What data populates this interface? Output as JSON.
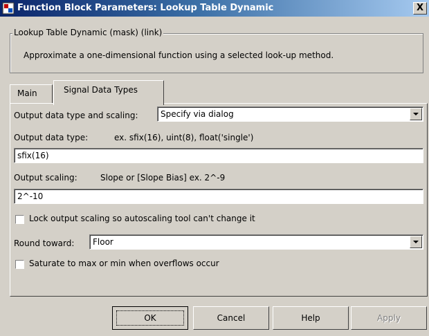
{
  "window": {
    "title": "Function Block Parameters: Lookup Table Dynamic",
    "close_label": "X"
  },
  "block": {
    "group_title": "Lookup Table Dynamic (mask) (link)",
    "description": "Approximate a one-dimensional function using a selected look-up method."
  },
  "tabs": [
    {
      "label": "Main"
    },
    {
      "label": "Signal Data Types",
      "selected": true
    }
  ],
  "form": {
    "output_type_scaling_label": "Output data type and scaling:",
    "output_type_scaling_value": "Specify via dialog",
    "output_data_type_label": "Output data type:",
    "output_data_type_hint": "ex. sfix(16),  uint(8),  float('single')",
    "output_data_type_value": "sfix(16)",
    "output_scaling_label": "Output scaling:",
    "output_scaling_hint": "Slope or [Slope Bias]   ex.  2^-9",
    "output_scaling_value": "2^-10",
    "lock_scaling_label": "Lock output scaling so autoscaling tool can't change it",
    "lock_scaling_checked": false,
    "round_toward_label": "Round toward:",
    "round_toward_value": "Floor",
    "saturate_label": "Saturate to max or min when overflows occur",
    "saturate_checked": false
  },
  "buttons": {
    "ok": "OK",
    "cancel": "Cancel",
    "help": "Help",
    "apply": "Apply"
  },
  "icons": {
    "app": "simulink-block-icon",
    "close": "close-icon",
    "dropdown": "chevron-down-icon"
  },
  "colors": {
    "titlebar_start": "#0a246a",
    "titlebar_end": "#a6caf0",
    "dialog_bg": "#d4d0c8"
  }
}
